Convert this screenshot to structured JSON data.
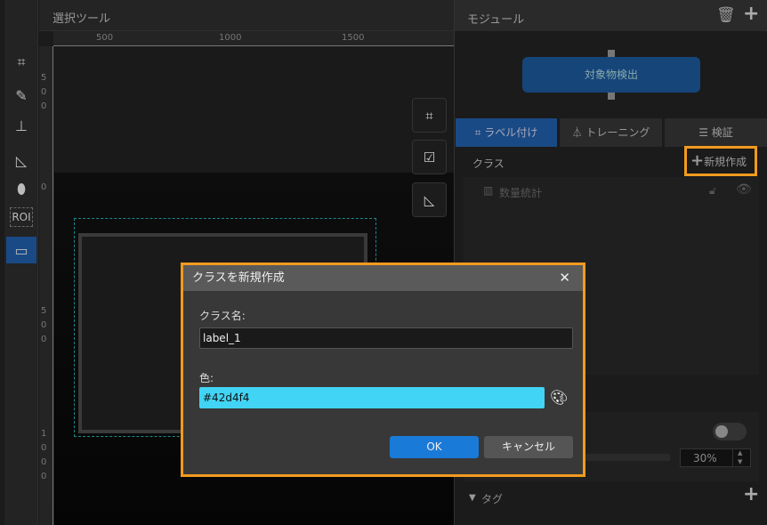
{
  "canvas": {
    "title": "選択ツール",
    "ruler_top": [
      "500",
      "1000",
      "1500"
    ],
    "ruler_left": [
      "5",
      "0",
      "0",
      "0",
      "5",
      "0",
      "0",
      "1",
      "0",
      "0",
      "0"
    ]
  },
  "toolbar": {
    "roi_label": "ROI"
  },
  "module": {
    "title": "モジュール",
    "node": "対象物検出"
  },
  "tabs": [
    {
      "label": "ラベル付け"
    },
    {
      "label": "トレーニング"
    },
    {
      "label": "検証"
    }
  ],
  "classes": {
    "title": "クラス",
    "new_label": "新規作成",
    "stats_label": "数量統計"
  },
  "settings": {
    "percent": "30%",
    "toggle_on": false
  },
  "tag": {
    "title": "タグ"
  },
  "dialog": {
    "title": "クラスを新規作成",
    "name_label": "クラス名:",
    "name_value": "label_1",
    "color_label": "色:",
    "color_value": "#42d4f4",
    "ok": "OK",
    "cancel": "キャンセル"
  },
  "colors": {
    "accent": "#1a4a85",
    "highlight": "#f29a1f",
    "class_color": "#42d4f4",
    "ok": "#1a7ad8"
  }
}
